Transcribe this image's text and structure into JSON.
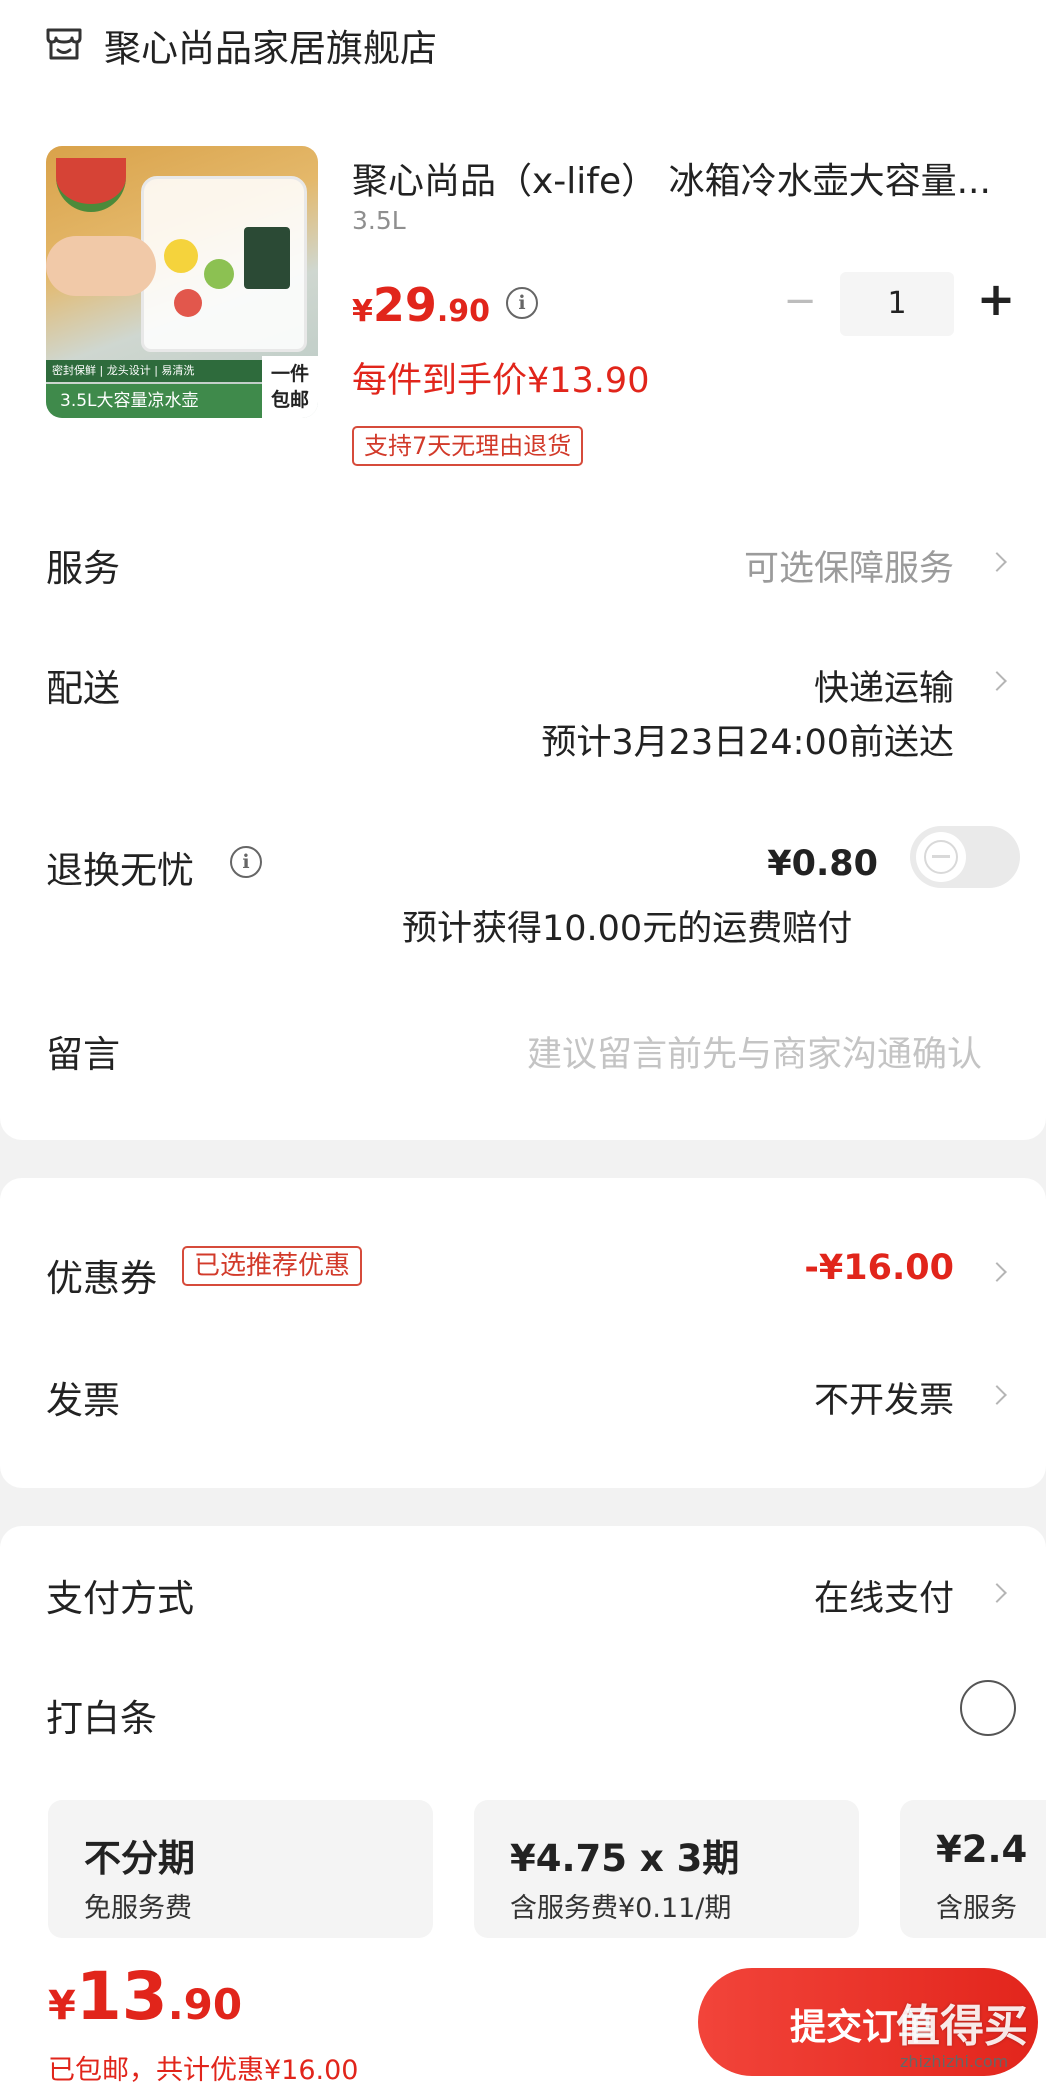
{
  "store": {
    "icon": "store-icon",
    "name": "聚心尚品家居旗舰店"
  },
  "product": {
    "thumb": {
      "icon": "product-thumbnail",
      "features": "密封保鲜 | 龙头设计 | 易清洗",
      "caption": "3.5L大容量凉水壶",
      "badge_line1": "一件",
      "badge_line2": "包邮"
    },
    "title": "聚心尚品（x-life） 冰箱冷水壶大容量...",
    "spec": "3.5L",
    "price_symbol": "¥",
    "price_int": "29",
    "price_dec": ".90",
    "final_price": "每件到手价¥13.90",
    "return_tag": "支持7天无理由退货",
    "qty_minus": "−",
    "qty_value": "1",
    "qty_plus": "+"
  },
  "rows": {
    "service": {
      "label": "服务",
      "value": "可选保障服务"
    },
    "delivery": {
      "label": "配送",
      "value": "快递运输",
      "eta": "预计3月23日24:00前送达"
    },
    "return_worry": {
      "label": "退换无忧",
      "value": "¥0.80",
      "note": "预计获得10.00元的运费赔付",
      "toggle_on": false
    },
    "message": {
      "label": "留言",
      "placeholder": "建议留言前先与商家沟通确认"
    },
    "coupon": {
      "label": "优惠券",
      "tag": "已选推荐优惠",
      "value": "-¥16.00"
    },
    "invoice": {
      "label": "发票",
      "value": "不开发票"
    },
    "payment": {
      "label": "支付方式",
      "value": "在线支付"
    },
    "baitiao": {
      "label": "打白条",
      "selected": false
    }
  },
  "installments": [
    {
      "title": "不分期",
      "sub": "免服务费"
    },
    {
      "title": "¥4.75 x 3期",
      "sub": "含服务费¥0.11/期"
    },
    {
      "title": "¥2.4",
      "sub": "含服务"
    }
  ],
  "bottom": {
    "price_symbol": "¥",
    "price_int": "13",
    "price_dec": ".90",
    "summary_free": "已包邮，",
    "summary_discount": "共计优惠¥16.00",
    "submit_label": "提交订单"
  },
  "watermark": {
    "text": "值得买",
    "site": "zhizhizhi.com"
  },
  "colors": {
    "accent": "#e1251b",
    "tag_border": "#d64b3b",
    "submit_start": "#f2443a",
    "submit_end": "#e2251c"
  }
}
